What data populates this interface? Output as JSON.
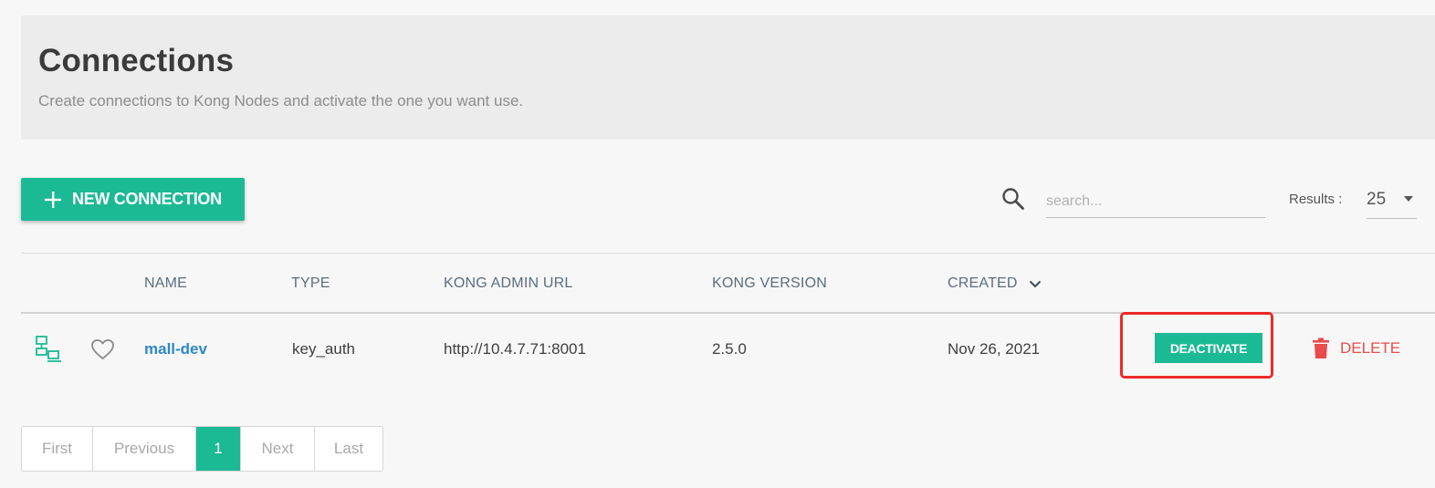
{
  "header": {
    "title": "Connections",
    "subtitle": "Create connections to Kong Nodes and activate the one you want use."
  },
  "toolbar": {
    "new_connection_label": "NEW CONNECTION",
    "search_placeholder": "search...",
    "search_value": "",
    "results_label": "Results :",
    "results_value": "25"
  },
  "table": {
    "columns": {
      "name": "NAME",
      "type": "TYPE",
      "url": "KONG ADMIN URL",
      "version": "KONG VERSION",
      "created": "CREATED"
    },
    "sort": {
      "column": "created",
      "direction": "desc"
    },
    "rows": [
      {
        "name": "mall-dev",
        "type": "key_auth",
        "url": "http://10.4.7.71:8001",
        "version": "2.5.0",
        "created": "Nov 26, 2021",
        "deactivate_label": "DEACTIVATE",
        "delete_label": "DELETE"
      }
    ]
  },
  "pagination": {
    "first": "First",
    "previous": "Previous",
    "current": "1",
    "next": "Next",
    "last": "Last"
  },
  "colors": {
    "accent": "#1cb995",
    "danger": "#e84c4c",
    "link": "#2d87c7",
    "highlight": "#ef2a2a"
  },
  "icons": {
    "plus": "plus-icon",
    "search": "search-icon",
    "caret": "caret-down-icon",
    "sort": "chevron-down-icon",
    "node": "network-nodes-icon",
    "favorite": "heart-icon",
    "delete": "trash-icon"
  }
}
